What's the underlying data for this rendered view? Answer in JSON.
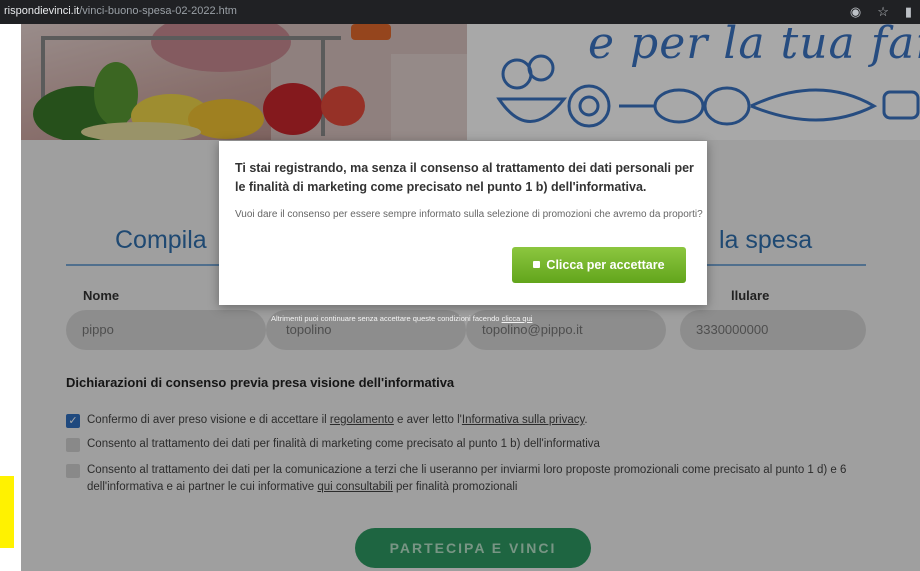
{
  "browser": {
    "url_domain": "rispondievinci.it",
    "url_path": "/vinci-buono-spesa-02-2022.htm"
  },
  "hero": {
    "tagline": "e per la tua fami"
  },
  "form": {
    "title_left": "Compila",
    "title_right": "la spesa",
    "labels": {
      "nome": "Nome",
      "cellulare": "llulare"
    },
    "values": {
      "nome": "pippo",
      "cognome": "topolino",
      "email": "topolino@pippo.it",
      "cellulare": "3330000000"
    }
  },
  "consent": {
    "heading": "Dichiarazioni di consenso previa presa visione dell'informativa",
    "item1": {
      "checked": true,
      "text_before": "Confermo di aver preso visione e di accettare il ",
      "link1": "regolamento",
      "text_mid": " e aver letto l'",
      "link2": "Informativa sulla privacy",
      "text_after": "."
    },
    "item2": {
      "checked": false,
      "text": "Consento al trattamento dei dati per finalità di marketing come precisato al punto 1 b) dell'informativa"
    },
    "item3": {
      "checked": false,
      "text_before": "Consento al trattamento dei dati per la comunicazione a terzi che li useranno per inviarmi loro proposte promozionali come precisato al punto 1 d) e 6 dell'informativa e ai partner le cui informative ",
      "link": "qui consultabili",
      "text_after": " per finalità promozionali"
    }
  },
  "cta": {
    "label": "PARTECIPA E VINCI"
  },
  "modal": {
    "title": "Ti stai registrando, ma senza il consenso al trattamento dei dati personali per le finalità di marketing come precisato nel punto 1 b) dell'informativa.",
    "text": "Vuoi dare il consenso per essere sempre informato sulla selezione di promozioni che avremo da proporti?",
    "accept_label": "Clicca per accettare",
    "continue_text": "Altrimenti puoi continuare senza accettare queste condizioni facendo ",
    "continue_link": "clicca qui"
  },
  "colors": {
    "brand_blue": "#2f6fae",
    "accept_green": "#75b52a",
    "cta_green": "#2e9a63",
    "marker_yellow": "#fff200"
  }
}
